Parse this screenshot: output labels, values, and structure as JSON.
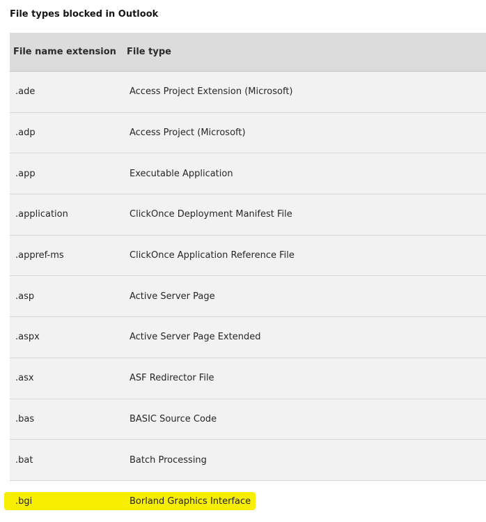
{
  "title": "File types blocked in Outlook",
  "table": {
    "headers": [
      "File name extension",
      "File type"
    ],
    "rows": [
      {
        "ext": ".ade",
        "type": "Access Project Extension (Microsoft)"
      },
      {
        "ext": ".adp",
        "type": "Access Project (Microsoft)"
      },
      {
        "ext": ".app",
        "type": "Executable Application"
      },
      {
        "ext": ".application",
        "type": "ClickOnce Deployment Manifest File"
      },
      {
        "ext": ".appref-ms",
        "type": "ClickOnce Application Reference File"
      },
      {
        "ext": ".asp",
        "type": "Active Server Page"
      },
      {
        "ext": ".aspx",
        "type": "Active Server Page Extended"
      },
      {
        "ext": ".asx",
        "type": "ASF Redirector File"
      },
      {
        "ext": ".bas",
        "type": "BASIC Source Code"
      },
      {
        "ext": ".bat",
        "type": "Batch Processing"
      },
      {
        "ext": ".bgi",
        "type": "Borland Graphics Interface"
      }
    ]
  },
  "colors": {
    "highlight": "#f7ee00",
    "header_bg": "#dcdcdc",
    "row_bg": "#f2f2f2"
  }
}
